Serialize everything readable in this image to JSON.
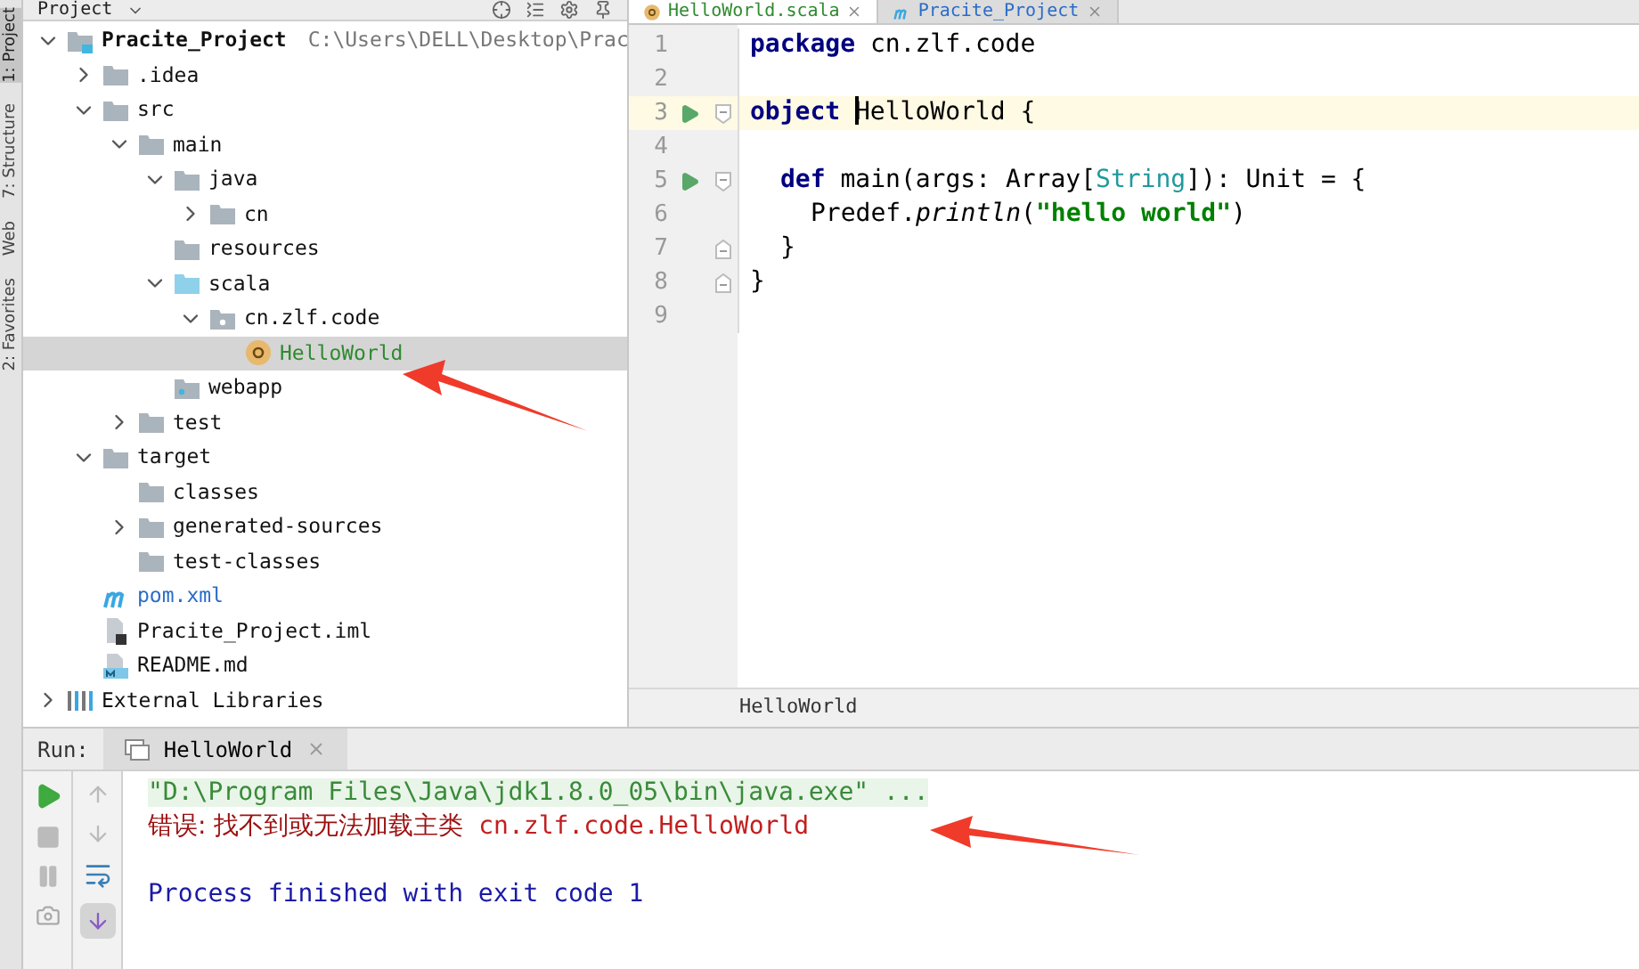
{
  "side_strip": {
    "labels": [
      {
        "text": "1: Project",
        "selected": true
      },
      {
        "text": "7: Structure",
        "selected": false
      },
      {
        "text": "Web",
        "selected": false
      },
      {
        "text": "2: Favorites",
        "selected": false
      }
    ]
  },
  "project_panel": {
    "title": "Project",
    "tree": [
      {
        "name": "Pracite_Project",
        "kind": "module",
        "path": "C:\\Users\\DELL\\Desktop\\Prac",
        "expanded": true,
        "selected": false,
        "children": [
          {
            "name": ".idea",
            "kind": "folder",
            "expanded": false,
            "selected": false
          },
          {
            "name": "src",
            "kind": "folder",
            "expanded": true,
            "selected": false,
            "children": [
              {
                "name": "main",
                "kind": "folder",
                "expanded": true,
                "selected": false,
                "children": [
                  {
                    "name": "java",
                    "kind": "folder",
                    "expanded": true,
                    "selected": false,
                    "children": [
                      {
                        "name": "cn",
                        "kind": "folder",
                        "expanded": false,
                        "selected": false
                      }
                    ]
                  },
                  {
                    "name": "resources",
                    "kind": "folder",
                    "selected": false
                  },
                  {
                    "name": "scala",
                    "kind": "source-folder",
                    "expanded": true,
                    "selected": false,
                    "children": [
                      {
                        "name": "cn.zlf.code",
                        "kind": "package",
                        "expanded": true,
                        "selected": false,
                        "children": [
                          {
                            "name": "HelloWorld",
                            "kind": "scala-object",
                            "color": "#2f8a2f",
                            "selected": true
                          }
                        ]
                      }
                    ]
                  },
                  {
                    "name": "webapp",
                    "kind": "web-folder",
                    "selected": false
                  }
                ]
              },
              {
                "name": "test",
                "kind": "folder",
                "expanded": false,
                "selected": false
              }
            ]
          },
          {
            "name": "target",
            "kind": "folder",
            "expanded": true,
            "selected": false,
            "children": [
              {
                "name": "classes",
                "kind": "folder",
                "selected": false
              },
              {
                "name": "generated-sources",
                "kind": "folder",
                "expanded": false,
                "selected": false
              },
              {
                "name": "test-classes",
                "kind": "folder",
                "selected": false
              }
            ]
          },
          {
            "name": "pom.xml",
            "kind": "maven",
            "color": "#2a6cc9",
            "selected": false
          },
          {
            "name": "Pracite_Project.iml",
            "kind": "iml",
            "selected": false
          },
          {
            "name": "README.md",
            "kind": "markdown",
            "selected": false
          }
        ]
      },
      {
        "name": "External Libraries",
        "kind": "libraries",
        "expanded": false,
        "selected": false
      }
    ]
  },
  "editor": {
    "tabs": [
      {
        "label": "HelloWorld.scala",
        "kind": "scala-object",
        "selected": true
      },
      {
        "label": "Pracite_Project",
        "kind": "maven",
        "selected": false
      }
    ],
    "lines": [
      {
        "number": "1",
        "tokens": [
          {
            "kind": "keyword",
            "text": "package"
          },
          {
            "kind": "plain",
            "text": " cn.zlf.code"
          }
        ]
      },
      {
        "number": "2"
      },
      {
        "number": "3",
        "run": true,
        "fold_start": true,
        "current": true,
        "tokens": [
          {
            "kind": "keyword",
            "text": "object"
          },
          {
            "kind": "plain",
            "text": " HelloWorld {"
          }
        ]
      },
      {
        "number": "4"
      },
      {
        "number": "5",
        "run": true,
        "fold_start": true,
        "tokens": [
          {
            "kind": "keyword",
            "text": "def"
          },
          {
            "kind": "plain",
            "text": " main(args: Array["
          },
          {
            "kind": "type",
            "text": "String"
          },
          {
            "kind": "plain",
            "text": "]): Unit = {"
          }
        ]
      },
      {
        "number": "6",
        "tokens": [
          {
            "kind": "plain",
            "text": "Predef."
          },
          {
            "kind": "method",
            "text": "println"
          },
          {
            "kind": "plain",
            "text": "("
          },
          {
            "kind": "string",
            "text": "\"hello world\""
          },
          {
            "kind": "plain",
            "text": ")"
          }
        ]
      },
      {
        "number": "7",
        "fold_end": true,
        "tokens": [
          {
            "kind": "plain",
            "text": "}"
          }
        ]
      },
      {
        "number": "8",
        "fold_end": true,
        "tokens": [
          {
            "kind": "plain",
            "text": "}"
          }
        ]
      },
      {
        "number": "9"
      }
    ],
    "breadcrumb": "HelloWorld"
  },
  "run_panel": {
    "label": "Run:",
    "tab": "HelloWorld",
    "console": [
      {
        "kind": "command",
        "text": "\"D:\\Program Files\\Java\\jdk1.8.0_05\\bin\\java.exe\" ..."
      },
      {
        "kind": "error",
        "parts": [
          "错误: 找不到或无法加载主类",
          "cn.zlf.code.HelloWorld"
        ]
      },
      {
        "kind": "exit",
        "text": "Process finished with exit code 1"
      }
    ]
  }
}
